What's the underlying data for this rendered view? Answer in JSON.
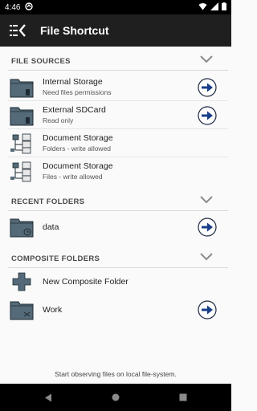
{
  "status_bar": {
    "time": "4:46"
  },
  "app_bar": {
    "title": "File Shortcut"
  },
  "sections": {
    "file_sources": {
      "header": "FILE SOURCES",
      "items": [
        {
          "title": "Internal Storage",
          "subtitle": "Need files permissions",
          "icon": "folder-phone-icon"
        },
        {
          "title": "External SDCard",
          "subtitle": "Read only",
          "icon": "folder-sdcard-icon"
        },
        {
          "title": "Document Storage",
          "subtitle": "Folders - write allowed",
          "icon": "document-tree-icon"
        },
        {
          "title": "Document Storage",
          "subtitle": "Files - write allowed",
          "icon": "document-tree-icon"
        }
      ]
    },
    "recent_folders": {
      "header": "RECENT FOLDERS",
      "items": [
        {
          "title": "data",
          "icon": "folder-clock-icon"
        }
      ]
    },
    "composite_folders": {
      "header": "COMPOSITE FOLDERS",
      "items": [
        {
          "title": "New Composite Folder",
          "icon": "plus-icon"
        },
        {
          "title": "Work",
          "icon": "folder-shuffle-icon"
        }
      ]
    }
  },
  "footer": {
    "text": "Start observing files on local file-system."
  },
  "colors": {
    "app_bar": "#1f1f1f",
    "folder": "#556a78",
    "arrow": "#1a3f8a",
    "background": "#fafafa"
  }
}
